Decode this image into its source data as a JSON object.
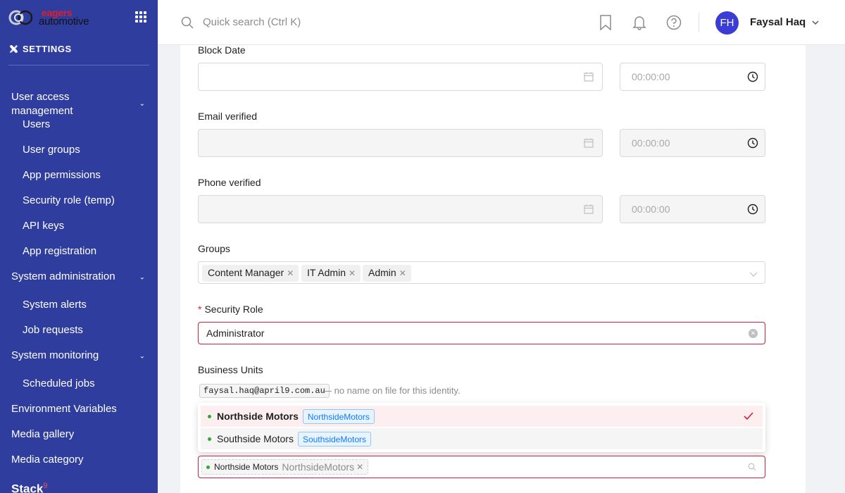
{
  "brand": {
    "line1": "eagers",
    "line2": "automotive"
  },
  "sidebar": {
    "section_title": "SETTINGS",
    "items": [
      {
        "label": "User access\nmanagement",
        "type": "group"
      },
      {
        "label": "Users",
        "type": "sub"
      },
      {
        "label": "User groups",
        "type": "sub"
      },
      {
        "label": "App permissions",
        "type": "sub"
      },
      {
        "label": "Security role (temp)",
        "type": "sub"
      },
      {
        "label": "API keys",
        "type": "sub"
      },
      {
        "label": "App registration",
        "type": "sub"
      },
      {
        "label": "System administration",
        "type": "group"
      },
      {
        "label": "System alerts",
        "type": "sub"
      },
      {
        "label": "Job requests",
        "type": "sub"
      },
      {
        "label": "System monitoring",
        "type": "group"
      },
      {
        "label": "Scheduled jobs",
        "type": "sub"
      },
      {
        "label": "Environment Variables",
        "type": "top"
      },
      {
        "label": "Media gallery",
        "type": "top"
      },
      {
        "label": "Media category",
        "type": "top"
      },
      {
        "label": "Stack",
        "type": "top",
        "badge": "9"
      }
    ]
  },
  "header": {
    "search_placeholder": "Quick search (Ctrl K)",
    "user_initials": "FH",
    "user_name": "Faysal Haq"
  },
  "form": {
    "block_date": {
      "label": "Block Date",
      "time": "00:00:00"
    },
    "email_verified": {
      "label": "Email verified",
      "time": "00:00:00"
    },
    "phone_verified": {
      "label": "Phone verified",
      "time": "00:00:00"
    },
    "groups": {
      "label": "Groups",
      "tags": [
        "Content Manager",
        "IT Admin",
        "Admin"
      ]
    },
    "security_role": {
      "label": "Security Role",
      "required_mark": "*",
      "value": "Administrator"
    },
    "business_units": {
      "label": "Business Units",
      "email": "faysal.haq@april9.com.au",
      "note": "— no name on file for this identity.",
      "options": [
        {
          "name": "Northside Motors",
          "code": "NorthsideMotors",
          "selected": true
        },
        {
          "name": "Southside Motors",
          "code": "SouthsideMotors",
          "selected": false
        }
      ],
      "selected_tag": {
        "name": "Northside Motors",
        "code": "NorthsideMotors"
      }
    }
  },
  "colors": {
    "sidebar_bg": "#2f3e9e",
    "avatar_bg": "#3b3bd6",
    "error_border": "#d4203a",
    "selected_option_bg": "#fdeff0",
    "check_color": "#d4203a",
    "status_dot": "#2ea82e"
  }
}
